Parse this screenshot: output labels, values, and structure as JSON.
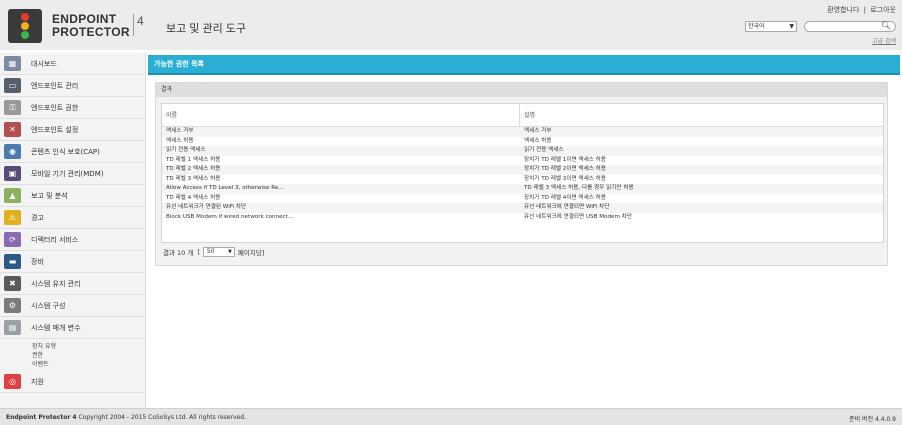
{
  "header": {
    "brand_line1": "ENDPOINT",
    "brand_line2": "PROTECTOR",
    "brand_version": "4",
    "app_title": "보고 및 관리 도구",
    "welcome": "환영합니다",
    "separator": "|",
    "logout": "로그아웃",
    "language": "한국어",
    "search_placeholder": "",
    "advanced_search": "고급 검색"
  },
  "sidebar": {
    "items": [
      {
        "label": "대시보드",
        "icon": "dashboard-icon",
        "color": "#7a8aa0"
      },
      {
        "label": "엔드포인트 관리",
        "icon": "endpoint-management-icon",
        "color": "#55606e"
      },
      {
        "label": "엔드포인트 권한",
        "icon": "endpoint-rights-icon",
        "color": "#9a9a9a"
      },
      {
        "label": "엔드포인트 설정",
        "icon": "endpoint-settings-icon",
        "color": "#b05050"
      },
      {
        "label": "콘텐츠 인식 보호(CAP)",
        "icon": "cap-icon",
        "color": "#4a7ab0"
      },
      {
        "label": "모바일 기기 관리(MDM)",
        "icon": "mdm-icon",
        "color": "#5a4a7a"
      },
      {
        "label": "보고 및 분석",
        "icon": "reports-icon",
        "color": "#8ab060"
      },
      {
        "label": "경고",
        "icon": "alerts-icon",
        "color": "#e0b020"
      },
      {
        "label": "디렉터리 서비스",
        "icon": "directory-icon",
        "color": "#8a6ab0"
      },
      {
        "label": "장비",
        "icon": "appliance-icon",
        "color": "#2a5a8a"
      },
      {
        "label": "시스템 유지 관리",
        "icon": "maintenance-icon",
        "color": "#5a5a5a"
      },
      {
        "label": "시스템 구성",
        "icon": "configuration-icon",
        "color": "#7a7a7a"
      },
      {
        "label": "시스템 매개 변수",
        "icon": "parameters-icon",
        "color": "#9aa0a8"
      }
    ],
    "sub_items": [
      "장치 유형",
      "권한",
      "이벤트"
    ],
    "support": {
      "label": "지원",
      "icon": "support-icon",
      "color": "#e04040"
    }
  },
  "main": {
    "section_title": "가능한 권한 목록",
    "panel_title": "결과",
    "columns": [
      "이름",
      "설명"
    ],
    "rows": [
      [
        "액세스 거부",
        "액세스 거부"
      ],
      [
        "액세스 허용",
        "액세스 허용"
      ],
      [
        "읽기 전용 액세스",
        "읽기 전용 액세스"
      ],
      [
        "TD 레벨 1 액세스 허용",
        "장치가 TD 레벨 1이면 액세스 허용"
      ],
      [
        "TD 레벨 2 액세스 허용",
        "장치가 TD 레벨 2이면 액세스 허용"
      ],
      [
        "TD 레벨 3 액세스 허용",
        "장치가 TD 레벨 3이면 액세스 허용"
      ],
      [
        "Allow Access if TD Level 3, otherwise Re...",
        "TD 레벨 3 액세스 허용, 다를 경우 읽기만 허용"
      ],
      [
        "TD 레벨 4 액세스 허용",
        "장치가 TD 레벨 4이면 액세스 허용"
      ],
      [
        "유선 네트워크가 연결된 WiFi 차단",
        "유선 네트워크에 연결되면 WiFi 차단"
      ],
      [
        "Block USB Modem if wired network connect...",
        "유선 네트워크에 연결되면 USB Modem 차단"
      ]
    ],
    "pager": {
      "results_prefix": "결과 10 개",
      "bracket_open": "[",
      "page_size": "50",
      "suffix": "페이지당]"
    }
  },
  "footer": {
    "product": "Endpoint Protector 4",
    "copyright": "Copyright 2004 - 2015 CoSoSys Ltd. All rights reserved.",
    "version": "준비 버전 4.4.0.9"
  }
}
